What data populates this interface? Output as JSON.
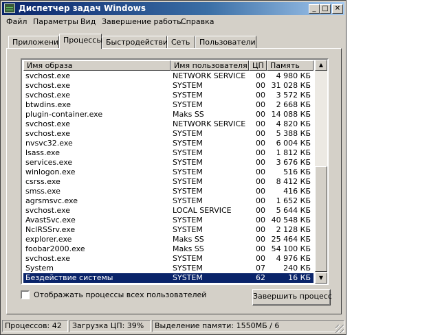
{
  "window": {
    "title": "Диспетчер задач Windows"
  },
  "titlebar_buttons": {
    "minimize": "_",
    "maximize": "□",
    "close": "✕"
  },
  "menu": [
    {
      "label": "Файл"
    },
    {
      "label": "Параметры"
    },
    {
      "label": "Вид"
    },
    {
      "label": "Завершение работы"
    },
    {
      "label": "Справка"
    }
  ],
  "tabs": [
    {
      "label": "Приложения"
    },
    {
      "label": "Процессы",
      "active": true
    },
    {
      "label": "Быстродействие"
    },
    {
      "label": "Сеть"
    },
    {
      "label": "Пользователи"
    }
  ],
  "table": {
    "columns": [
      "Имя образа",
      "Имя пользователя",
      "ЦП",
      "Память"
    ],
    "rows": [
      [
        "svchost.exe",
        "NETWORK SERVICE",
        "00",
        "4 980 КБ"
      ],
      [
        "svchost.exe",
        "SYSTEM",
        "00",
        "31 028 КБ"
      ],
      [
        "svchost.exe",
        "SYSTEM",
        "00",
        "3 572 КБ"
      ],
      [
        "btwdins.exe",
        "SYSTEM",
        "00",
        "2 668 КБ"
      ],
      [
        "plugin-container.exe",
        "Maks SS",
        "00",
        "14 088 КБ"
      ],
      [
        "svchost.exe",
        "NETWORK SERVICE",
        "00",
        "4 820 КБ"
      ],
      [
        "svchost.exe",
        "SYSTEM",
        "00",
        "5 388 КБ"
      ],
      [
        "nvsvc32.exe",
        "SYSTEM",
        "00",
        "6 004 КБ"
      ],
      [
        "lsass.exe",
        "SYSTEM",
        "00",
        "1 812 КБ"
      ],
      [
        "services.exe",
        "SYSTEM",
        "00",
        "3 676 КБ"
      ],
      [
        "winlogon.exe",
        "SYSTEM",
        "00",
        "516 КБ"
      ],
      [
        "csrss.exe",
        "SYSTEM",
        "00",
        "8 412 КБ"
      ],
      [
        "smss.exe",
        "SYSTEM",
        "00",
        "416 КБ"
      ],
      [
        "agrsmsvc.exe",
        "SYSTEM",
        "00",
        "1 652 КБ"
      ],
      [
        "svchost.exe",
        "LOCAL SERVICE",
        "00",
        "5 644 КБ"
      ],
      [
        "AvastSvc.exe",
        "SYSTEM",
        "00",
        "40 548 КБ"
      ],
      [
        "NclRSSrv.exe",
        "SYSTEM",
        "00",
        "2 128 КБ"
      ],
      [
        "explorer.exe",
        "Maks SS",
        "00",
        "25 464 КБ"
      ],
      [
        "foobar2000.exe",
        "Maks SS",
        "00",
        "54 100 КБ"
      ],
      [
        "svchost.exe",
        "SYSTEM",
        "00",
        "4 976 КБ"
      ],
      [
        "System",
        "SYSTEM",
        "07",
        "240 КБ"
      ],
      [
        "Бездействие системы",
        "SYSTEM",
        "62",
        "16 КБ"
      ]
    ],
    "selected_index": 21
  },
  "scrollbar": {
    "up": "▲",
    "down": "▼"
  },
  "show_all_users": {
    "label": "Отображать процессы всех пользователей",
    "checked": false
  },
  "end_process_button": "Завершить процесс",
  "status": {
    "processes": "Процессов: 42",
    "cpu": "Загрузка ЦП: 39%",
    "memory": "Выделение памяти: 1550МБ / 6"
  },
  "colors": {
    "title_gradient_start": "#0a246a",
    "selection": "#0a246a",
    "face": "#d4d0c8"
  }
}
